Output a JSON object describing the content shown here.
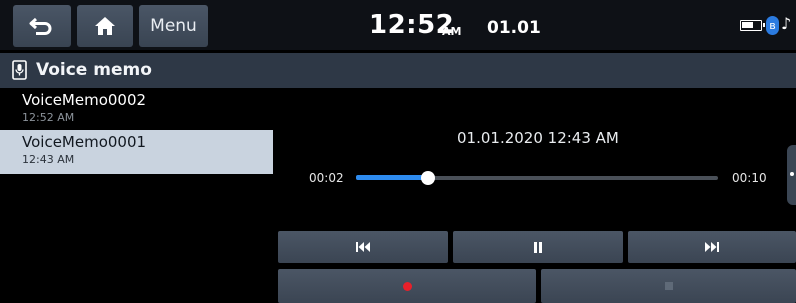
{
  "top_bar": {
    "back_icon": "back-arrow-icon",
    "home_icon": "home-icon",
    "menu_label": "Menu",
    "time": "12:52",
    "ampm": "AM",
    "date": "01.01",
    "battery_icon": "battery-icon",
    "bluetooth_icon": "bluetooth-icon",
    "music_icon": "music-note-icon"
  },
  "title_bar": {
    "icon": "voice-memo-icon",
    "title": "Voice memo"
  },
  "memo_list": [
    {
      "name": "VoiceMemo0002",
      "time": "12:52 AM",
      "selected": false
    },
    {
      "name": "VoiceMemo0001",
      "time": "12:43 AM",
      "selected": true
    }
  ],
  "player": {
    "recorded_at": "01.01.2020 12:43 AM",
    "current_time": "00:02",
    "duration": "00:10",
    "progress_fraction": 0.2
  },
  "controls": {
    "prev_icon": "skip-previous-icon",
    "pause_icon": "pause-icon",
    "next_icon": "skip-next-icon",
    "record_icon": "record-icon",
    "stop_icon": "stop-icon"
  },
  "colors": {
    "accent": "#2e8cf0",
    "record": "#e8202a",
    "selected_row": "#c9d3df",
    "title_bar": "#2e3846"
  }
}
